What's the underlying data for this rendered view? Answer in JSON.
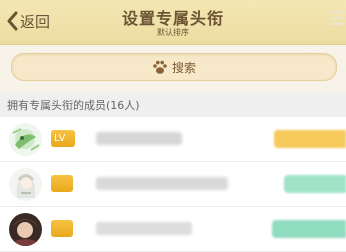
{
  "header": {
    "back_label": "返回",
    "title": "设置专属头衔",
    "subtitle": "默认排序",
    "back_icon": "chevron-left-icon",
    "menu_icon": "hamburger-menu-icon"
  },
  "search": {
    "label": "搜索",
    "icon": "paw-icon"
  },
  "section": {
    "title": "拥有专属头衔的成员(16人)"
  },
  "members": [
    {
      "level_label": "LV",
      "tag_color": "#f5c95a"
    },
    {
      "level_label": "",
      "tag_color": "#9ee3c6"
    },
    {
      "level_label": "",
      "tag_color": "#8fdcc0"
    }
  ],
  "colors": {
    "header_bg": "#f0e2a8",
    "header_text": "#6b5333",
    "level_badge": "#f0b429"
  }
}
